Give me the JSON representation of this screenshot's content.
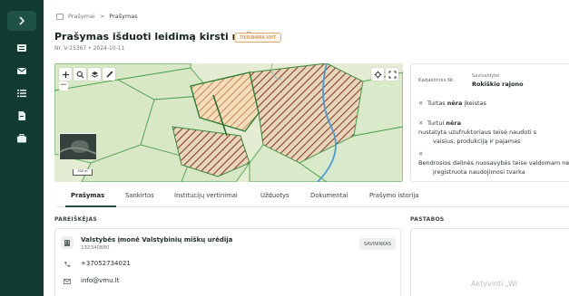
{
  "breadcrumb": {
    "root": "Prašymai",
    "separator": ">",
    "current": "Prašymas"
  },
  "header": {
    "title": "Prašymas išduoti leidimą kirsti mišką",
    "badge": "TIKRINAMA VMT",
    "subtitle": "Nr. V-15367 • 2024-10-11"
  },
  "map": {
    "scale_label": "300 m"
  },
  "info": {
    "kad_label": "Kadastrinis Nr.",
    "sav_label": "Savivaldybė",
    "sav_value": "Rokiškio rajono",
    "conditions": [
      {
        "pre": "Turtas ",
        "bold": "nėra",
        "post": " įkeistas",
        "line2": ""
      },
      {
        "pre": "Turtui ",
        "bold": "nėra",
        "post": " nustatyta uzufruktoriaus teisė naudoti s",
        "line2": "vaisius, produkciją ir pajamas"
      },
      {
        "pre": "Bendrosios dalinės nuosavybės teise valdomam ne",
        "bold": "",
        "post": "",
        "line2": "įregistruota naudojimosi tvarka"
      }
    ]
  },
  "tabs": [
    "Prašymas",
    "Sankirtos",
    "Institucijų vertinimai",
    "Užduotys",
    "Dokumentai",
    "Prašymo istorija"
  ],
  "applicant": {
    "section_title": "PAREIŠKĖJAS",
    "org_name": "Valstybės įmonė Valstybinių miškų urėdija",
    "org_code": "132340880",
    "role": "SAVININKAS",
    "phone": "+37052734021",
    "email": "info@vmu.lt"
  },
  "notes": {
    "section_title": "PASTABOS"
  },
  "watermark": "Aktyvinti „Wi",
  "colors": {
    "sidebar": "#113a31",
    "accent": "#1b4d41",
    "badge": "#d47a2f"
  }
}
